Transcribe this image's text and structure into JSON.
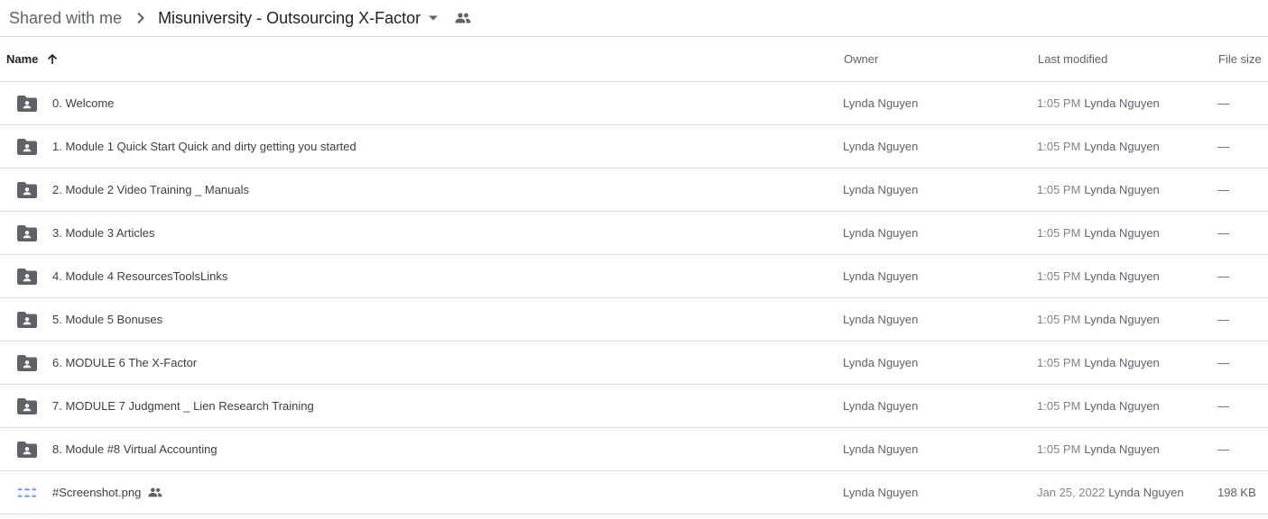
{
  "breadcrumb": {
    "root": "Shared with me",
    "current": "Misuniversity - Outsourcing X-Factor"
  },
  "columns": {
    "name": "Name",
    "owner": "Owner",
    "last_modified": "Last modified",
    "file_size": "File size",
    "sort": "ascending"
  },
  "files": [
    {
      "name": "0. Welcome",
      "type": "shared-folder",
      "owner": "Lynda Nguyen",
      "modified_time": "1:05 PM",
      "modified_by": "Lynda Nguyen",
      "size": "—"
    },
    {
      "name": "1. Module 1 Quick Start Quick and dirty getting you started",
      "type": "shared-folder",
      "owner": "Lynda Nguyen",
      "modified_time": "1:05 PM",
      "modified_by": "Lynda Nguyen",
      "size": "—"
    },
    {
      "name": "2. Module 2 Video Training _ Manuals",
      "type": "shared-folder",
      "owner": "Lynda Nguyen",
      "modified_time": "1:05 PM",
      "modified_by": "Lynda Nguyen",
      "size": "—"
    },
    {
      "name": "3. Module 3 Articles",
      "type": "shared-folder",
      "owner": "Lynda Nguyen",
      "modified_time": "1:05 PM",
      "modified_by": "Lynda Nguyen",
      "size": "—"
    },
    {
      "name": "4. Module 4 ResourcesToolsLinks",
      "type": "shared-folder",
      "owner": "Lynda Nguyen",
      "modified_time": "1:05 PM",
      "modified_by": "Lynda Nguyen",
      "size": "—"
    },
    {
      "name": "5. Module 5 Bonuses",
      "type": "shared-folder",
      "owner": "Lynda Nguyen",
      "modified_time": "1:05 PM",
      "modified_by": "Lynda Nguyen",
      "size": "—"
    },
    {
      "name": "6. MODULE 6 The X-Factor",
      "type": "shared-folder",
      "owner": "Lynda Nguyen",
      "modified_time": "1:05 PM",
      "modified_by": "Lynda Nguyen",
      "size": "—"
    },
    {
      "name": "7. MODULE 7 Judgment _ Lien Research Training",
      "type": "shared-folder",
      "owner": "Lynda Nguyen",
      "modified_time": "1:05 PM",
      "modified_by": "Lynda Nguyen",
      "size": "—"
    },
    {
      "name": "8. Module #8 Virtual Accounting",
      "type": "shared-folder",
      "owner": "Lynda Nguyen",
      "modified_time": "1:05 PM",
      "modified_by": "Lynda Nguyen",
      "size": "—"
    },
    {
      "name": "#Screenshot.png",
      "type": "image",
      "shared": true,
      "owner": "Lynda Nguyen",
      "modified_time": "Jan 25, 2022",
      "modified_by": "Lynda Nguyen",
      "size": "198 KB"
    }
  ],
  "colors": {
    "folder_icon": "#5f6368",
    "border": "#dadce0"
  }
}
